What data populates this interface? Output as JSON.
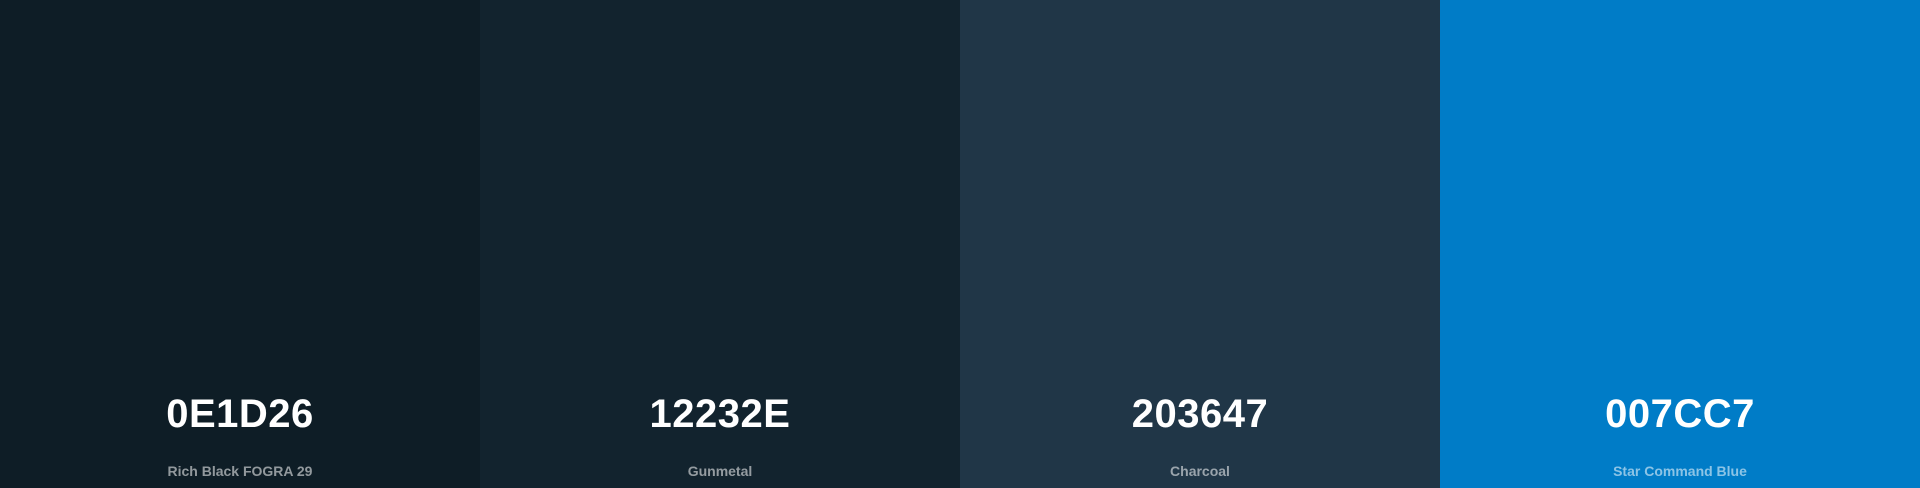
{
  "palette": {
    "swatches": [
      {
        "hex": "0E1D26",
        "name": "Rich Black FOGRA 29",
        "color": "#0E1D26"
      },
      {
        "hex": "12232E",
        "name": "Gunmetal",
        "color": "#12232E"
      },
      {
        "hex": "203647",
        "name": "Charcoal",
        "color": "#203647"
      },
      {
        "hex": "007CC7",
        "name": "Star Command Blue",
        "color": "#007CC7"
      }
    ]
  }
}
